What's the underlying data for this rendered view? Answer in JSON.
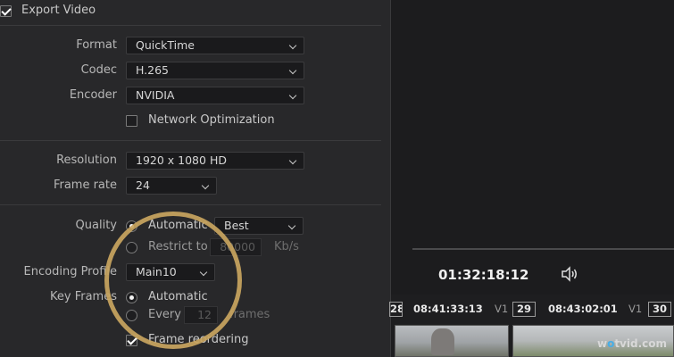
{
  "export": {
    "label": "Export Video",
    "checked": true
  },
  "format": {
    "label": "Format",
    "value": "QuickTime"
  },
  "codec": {
    "label": "Codec",
    "value": "H.265"
  },
  "encoder": {
    "label": "Encoder",
    "value": "NVIDIA"
  },
  "network_opt": {
    "label": "Network Optimization",
    "checked": false
  },
  "resolution": {
    "label": "Resolution",
    "value": "1920 x 1080 HD"
  },
  "frame_rate": {
    "label": "Frame rate",
    "value": "24"
  },
  "quality": {
    "label": "Quality",
    "automatic_label": "Automatic",
    "automatic_value": "Best",
    "restrict_label": "Restrict to",
    "restrict_value": "80000",
    "restrict_unit": "Kb/s",
    "selected": "automatic"
  },
  "encoding_profile": {
    "label": "Encoding Profile",
    "value": "Main10"
  },
  "key_frames": {
    "label": "Key Frames",
    "automatic_label": "Automatic",
    "every_label": "Every",
    "every_value": "12",
    "every_unit": "frames",
    "selected": "automatic"
  },
  "frame_reordering": {
    "label": "Frame reordering",
    "checked": true
  },
  "viewer": {
    "timecode": "01:32:18:12",
    "speaker_icon": "speaker-icon"
  },
  "timeline": {
    "clips": [
      {
        "num": "28",
        "tc": "08:41:33:13",
        "track": "V1"
      },
      {
        "num": "29",
        "tc": "08:43:02:01",
        "track": "V1"
      },
      {
        "num": "30"
      }
    ]
  },
  "watermark": {
    "prefix": "w",
    "suffix": "tvid.com"
  },
  "colors": {
    "panel": "#28282a",
    "accent_ring": "#c9a560",
    "background": "#1c1c1e"
  }
}
